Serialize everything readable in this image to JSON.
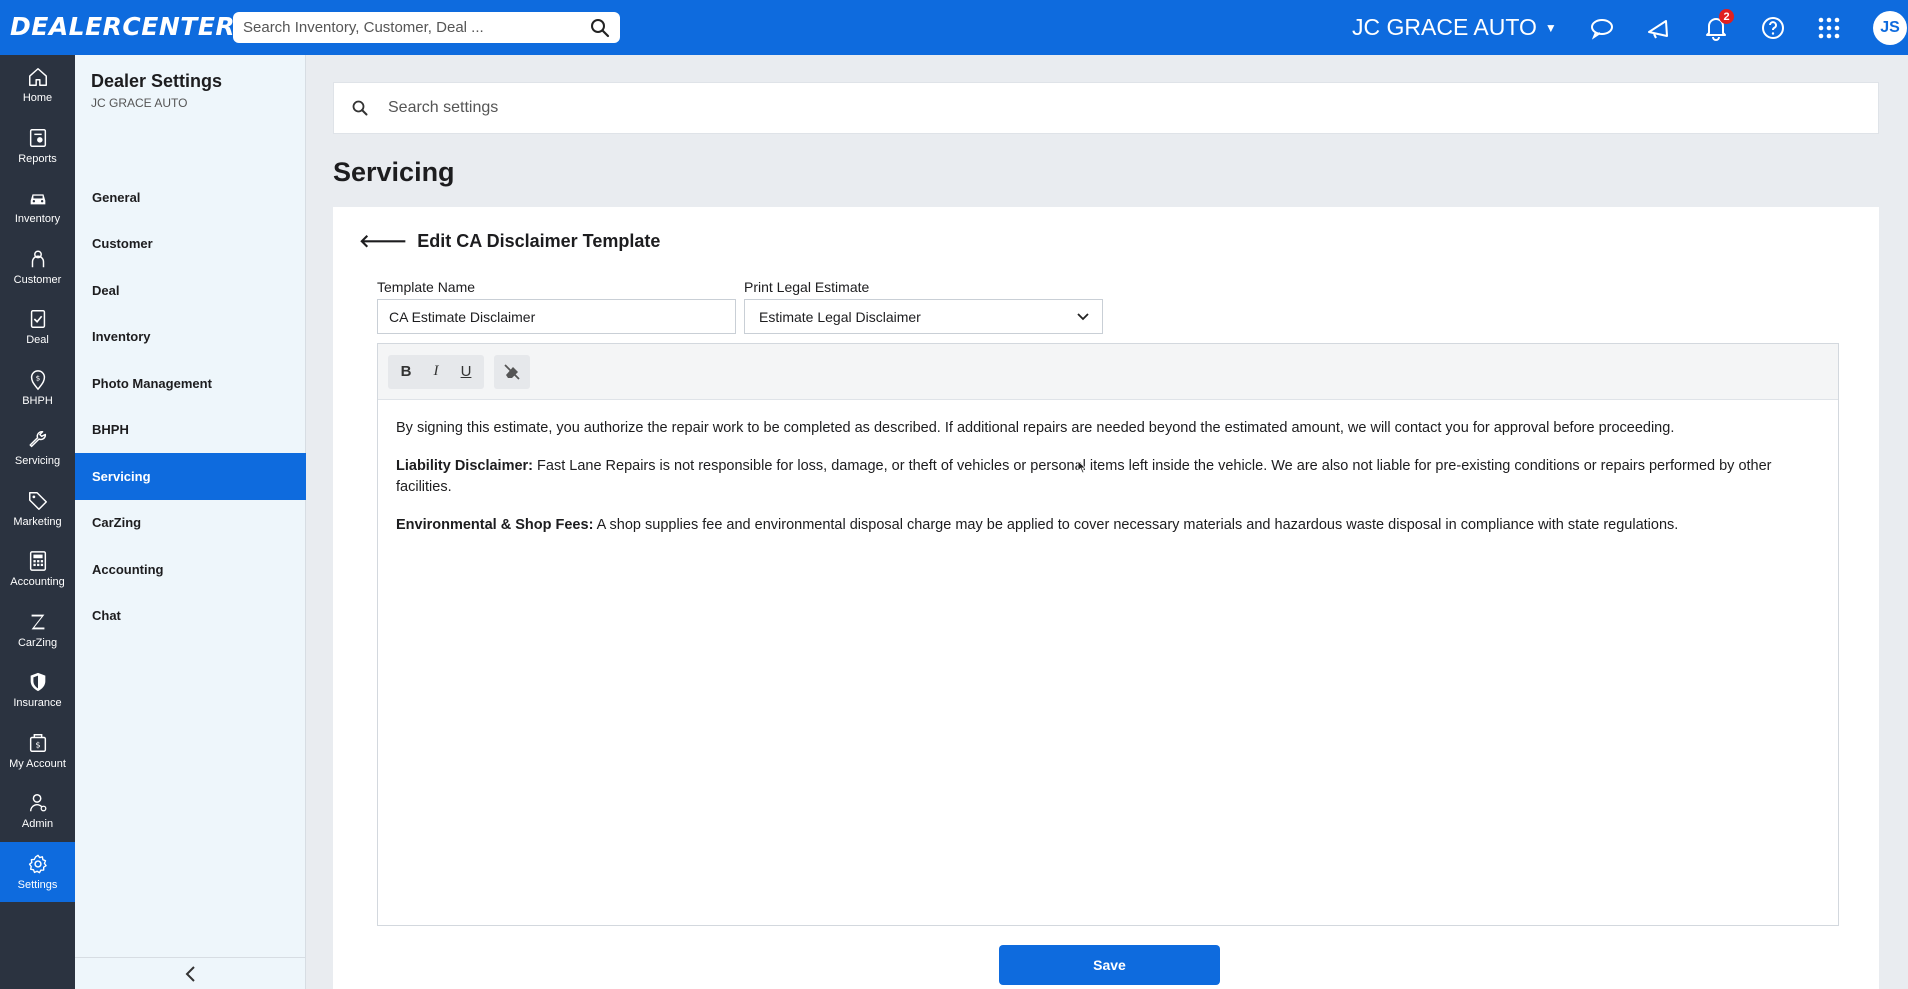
{
  "topbar": {
    "logo": "DEALERCENTER",
    "search_placeholder": "Search Inventory, Customer, Deal ...",
    "dealer_name": "JC GRACE AUTO",
    "notifications_count": "2",
    "avatar_initials": "JS"
  },
  "rail": {
    "items": [
      {
        "label": "Home",
        "icon": "home-icon"
      },
      {
        "label": "Reports",
        "icon": "reports-icon"
      },
      {
        "label": "Inventory",
        "icon": "car-icon"
      },
      {
        "label": "Customer",
        "icon": "customer-icon"
      },
      {
        "label": "Deal",
        "icon": "deal-icon"
      },
      {
        "label": "BHPH",
        "icon": "bhph-icon"
      },
      {
        "label": "Servicing",
        "icon": "wrench-icon"
      },
      {
        "label": "Marketing",
        "icon": "tag-icon"
      },
      {
        "label": "Accounting",
        "icon": "calculator-icon"
      },
      {
        "label": "CarZing",
        "icon": "carzing-icon"
      },
      {
        "label": "Insurance",
        "icon": "shield-icon"
      },
      {
        "label": "My Account",
        "icon": "account-icon"
      },
      {
        "label": "Admin",
        "icon": "admin-icon"
      },
      {
        "label": "Settings",
        "icon": "gear-icon"
      }
    ],
    "active": "Settings"
  },
  "settings_panel": {
    "title": "Dealer Settings",
    "subtitle": "JC GRACE AUTO",
    "items": [
      "General",
      "Customer",
      "Deal",
      "Inventory",
      "Photo Management",
      "BHPH",
      "Servicing",
      "CarZing",
      "Accounting",
      "Chat"
    ],
    "active": "Servicing"
  },
  "main": {
    "search_placeholder": "Search settings",
    "page_title": "Servicing",
    "card_title": "Edit CA Disclaimer Template",
    "template_name_label": "Template Name",
    "template_name_value": "CA Estimate Disclaimer",
    "print_label": "Print Legal Estimate",
    "print_value": "Estimate Legal Disclaimer",
    "toolbar": {
      "bold": "B",
      "italic": "I",
      "underline": "U"
    },
    "body": {
      "p1": "By signing this estimate, you authorize the repair work to be completed as described. If additional repairs are needed beyond the estimated amount, we will contact you for approval before proceeding.",
      "p2_label": "Liability Disclaimer:",
      "p2_text": " Fast Lane Repairs is not responsible for loss, damage, or theft of vehicles or personal items left inside the vehicle. We are also not liable for pre-existing conditions or repairs performed by other facilities.",
      "p3_label": "Environmental & Shop Fees:",
      "p3_text": " A shop supplies fee and environmental disposal charge may be applied to cover necessary materials and hazardous waste disposal in compliance with state regulations."
    },
    "save_label": "Save"
  }
}
